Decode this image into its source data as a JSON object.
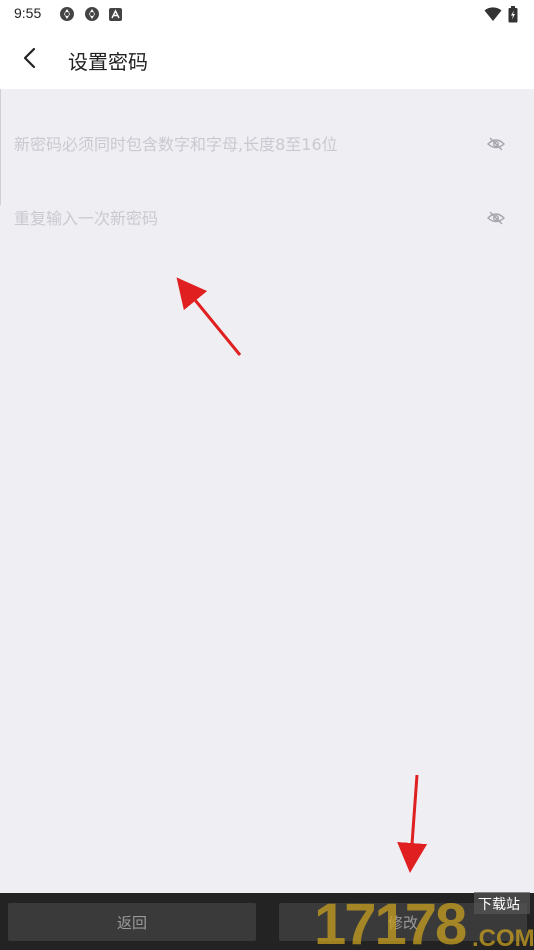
{
  "status_bar": {
    "time": "9:55",
    "left_icons": [
      "sync-icon",
      "sync-icon",
      "font-icon"
    ],
    "right_icons": [
      "wifi-icon",
      "battery-icon"
    ]
  },
  "header": {
    "title": "设置密码",
    "back_icon": "chevron-left-icon"
  },
  "form": {
    "new_password_placeholder": "新密码必须同时包含数字和字母,长度8至16位",
    "new_password_value": "",
    "confirm_password_placeholder": "重复输入一次新密码",
    "confirm_password_value": "",
    "visibility_icon": "eye-off-icon"
  },
  "bottom_bar": {
    "back_label": "返回",
    "modify_label": "修改"
  },
  "watermark": {
    "text": "17178",
    "suffix": ".COM",
    "badge": "下载站"
  },
  "colors": {
    "background": "#efeef3",
    "header": "#ffffff",
    "placeholder": "#c9c9d0",
    "bottom_bar": "#232323",
    "button": "#3a3a3a",
    "annotation_arrow": "#e02020",
    "watermark_gold": "#c8a020"
  }
}
